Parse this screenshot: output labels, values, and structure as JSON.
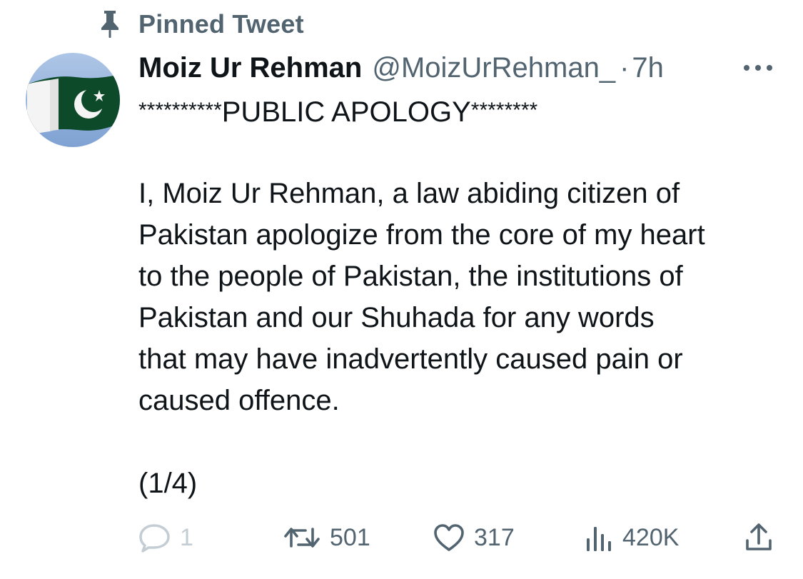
{
  "pinned": {
    "label": "Pinned Tweet",
    "icon": "pin-icon"
  },
  "author": {
    "name": "Moiz Ur Rehman",
    "handle": "@MoizUrRehman_",
    "separator": "·",
    "time": "7h",
    "avatar_icon": "pakistan-flag-avatar"
  },
  "tweet": {
    "headline_prefix": "**********",
    "headline_title": "PUBLIC APOLOGY",
    "headline_suffix": "********",
    "body": "I, Moiz Ur Rehman, a law abiding citizen of\nPakistan apologize from the core of my heart\nto the people of Pakistan, the institutions of\nPakistan and our Shuhada for any words\nthat may have inadvertently caused pain or\ncaused offence.",
    "thread_count": "(1/4)"
  },
  "actions": {
    "replies": "1",
    "retweets": "501",
    "likes": "317",
    "views": "420K"
  },
  "colors": {
    "secondary_text": "#536471",
    "primary_text": "#0f1419",
    "muted_reply": "#c4cdd3",
    "flag_green": "#0c4a2a"
  }
}
